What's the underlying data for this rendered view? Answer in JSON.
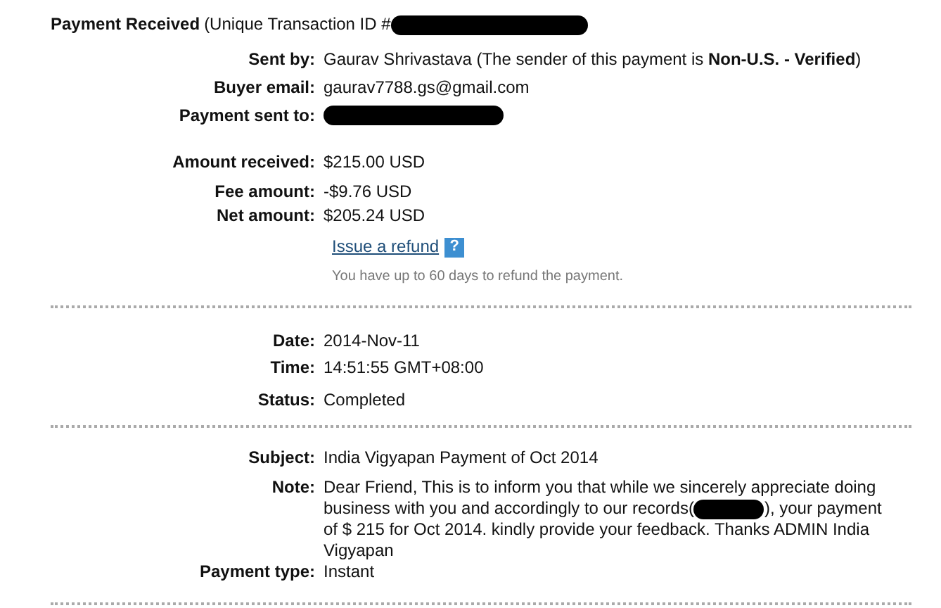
{
  "header": {
    "title": "Payment Received",
    "subtitle": "(Unique Transaction ID #",
    "redacted": true
  },
  "sections": [
    {
      "rows": [
        {
          "label": "Sent by:",
          "value": "Gaurav Shrivastava (The sender of this payment is **Non-U.S. - Verified**)"
        },
        {
          "label": "Buyer email:",
          "value": "gaurav7788.gs@gmail.com"
        },
        {
          "label": "Payment sent to:",
          "redacted": true
        },
        {
          "label": "Amount received:",
          "value": "$215.00 USD"
        },
        {
          "label": "Fee amount:",
          "value": "-$9.76 USD"
        },
        {
          "label": "Net amount:",
          "value": "$205.24 USD"
        }
      ],
      "refund": {
        "link": "Issue a refund",
        "help": "?",
        "hint": "You have up to 60 days to refund the payment."
      }
    },
    {
      "rows": [
        {
          "label": "Date:",
          "value": "2014-Nov-11"
        },
        {
          "label": "Time:",
          "value": "14:51:55 GMT+08:00"
        },
        {
          "label": "Status:",
          "value": "Completed"
        }
      ]
    },
    {
      "rows": [
        {
          "label": "Subject:",
          "value": "India Vigyapan Payment of Oct 2014"
        },
        {
          "label": "Note:",
          "lines": [
            [
              {
                "kind": "text",
                "text": "Dear Friend, This is to inform you that while we sincerely appreciate doing"
              }
            ],
            [
              {
                "kind": "text",
                "text": "business with you and accordingly to our records("
              },
              {
                "kind": "redaction"
              },
              {
                "kind": "text",
                "text": "), your payment"
              }
            ],
            [
              {
                "kind": "text",
                "text": "of $ 215 for Oct 2014. kindly provide your feedback. Thanks ADMIN India Vigyapan"
              }
            ]
          ]
        },
        {
          "label": "Payment type:",
          "value": "Instant"
        }
      ]
    }
  ]
}
